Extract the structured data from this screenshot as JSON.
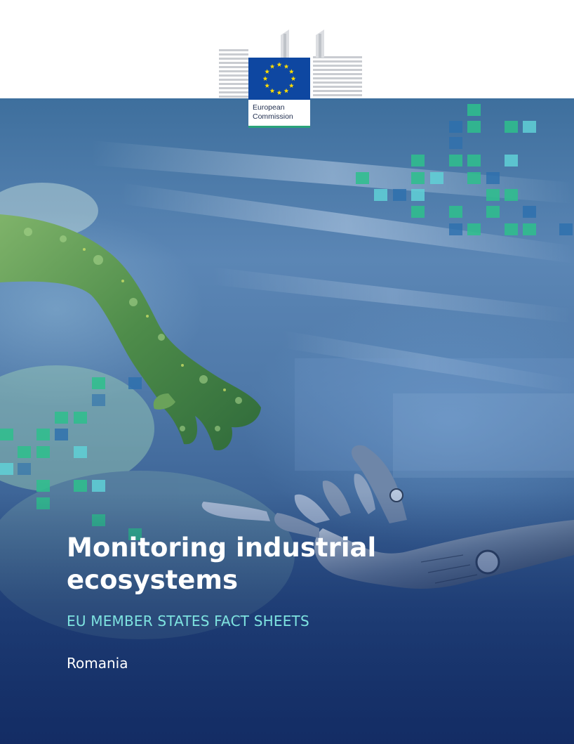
{
  "document": {
    "publisher_logo_label": "European Commission",
    "publisher_logo_line1": "European",
    "publisher_logo_line2": "Commission",
    "title": "Monitoring industrial ecosystems",
    "subtitle": "EU MEMBER STATES FACT SHEETS",
    "country": "Romania"
  },
  "colors": {
    "title_text": "#ffffff",
    "subtitle_text": "#7ee3e0",
    "eu_blue": "#0e47a1",
    "eu_star": "#ffdd00",
    "pixel_green": "#2ec08c",
    "pixel_teal": "#5fd0d6",
    "pixel_blue": "#2c6fae"
  },
  "imagery": {
    "hero_subject": "leafy-green-hand-and-robotic-hand",
    "icons": [
      "eu-flag-icon",
      "berlaymont-building-icon"
    ]
  }
}
